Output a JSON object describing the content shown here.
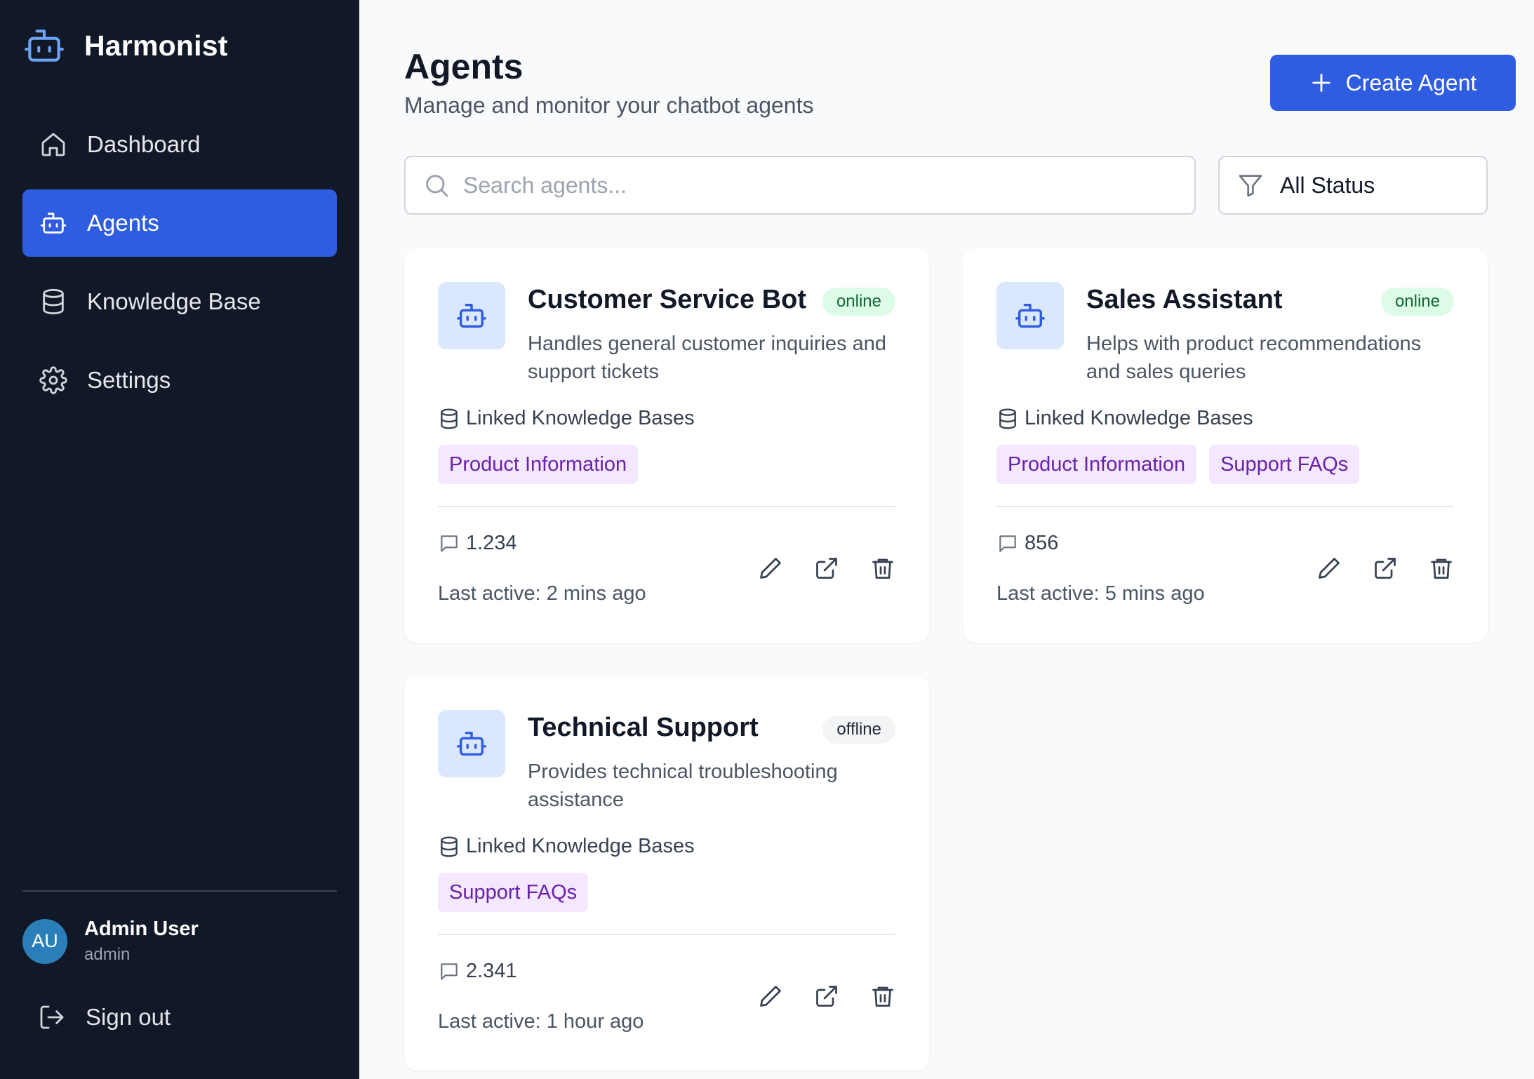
{
  "app": {
    "name": "Harmonist",
    "accent": "#2f5de1",
    "sidebar_bg": "#111827"
  },
  "sidebar": {
    "items": [
      {
        "label": "Dashboard",
        "icon": "home-icon",
        "active": false
      },
      {
        "label": "Agents",
        "icon": "bot-icon",
        "active": true
      },
      {
        "label": "Knowledge Base",
        "icon": "database-icon",
        "active": false
      },
      {
        "label": "Settings",
        "icon": "gear-icon",
        "active": false
      }
    ],
    "user": {
      "initials": "AU",
      "name": "Admin User",
      "role": "admin"
    },
    "signout_label": "Sign out"
  },
  "header": {
    "title": "Agents",
    "subtitle": "Manage and monitor your chatbot agents",
    "create_label": "Create Agent"
  },
  "search": {
    "placeholder": "Search agents...",
    "value": ""
  },
  "filter": {
    "label": "All Status"
  },
  "agents": [
    {
      "name": "Customer Service Bot",
      "status": "online",
      "description": "Handles general customer inquiries and support tickets",
      "kb_heading": "Linked Knowledge Bases",
      "knowledge_bases": [
        "Product Information"
      ],
      "messages": "1.234",
      "last_active": "Last active: 2 mins ago"
    },
    {
      "name": "Sales Assistant",
      "status": "online",
      "description": "Helps with product recommendations and sales queries",
      "kb_heading": "Linked Knowledge Bases",
      "knowledge_bases": [
        "Product Information",
        "Support FAQs"
      ],
      "messages": "856",
      "last_active": "Last active: 5 mins ago"
    },
    {
      "name": "Technical Support",
      "status": "offline",
      "description": "Provides technical troubleshooting assistance",
      "kb_heading": "Linked Knowledge Bases",
      "knowledge_bases": [
        "Support FAQs"
      ],
      "messages": "2.341",
      "last_active": "Last active: 1 hour ago"
    }
  ]
}
